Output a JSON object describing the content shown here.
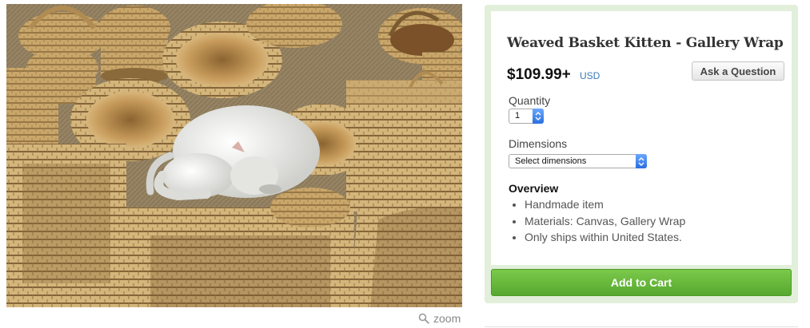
{
  "product": {
    "title": "Weaved Basket Kitten - Gallery Wrap",
    "price": "$109.99+",
    "currency": "USD",
    "ask_button": "Ask a Question",
    "quantity": {
      "label": "Quantity",
      "value": "1"
    },
    "dimensions": {
      "label": "Dimensions",
      "value": "Select dimensions"
    },
    "overview": {
      "heading": "Overview",
      "items": [
        "Handmade item",
        "Materials: Canvas, Gallery Wrap",
        "Only ships within United States."
      ]
    },
    "cart_button": "Add to Cart"
  },
  "photo": {
    "icon": "magnifier-icon",
    "zoom_label": "zoom",
    "colors": {
      "basket": "#c9a66a",
      "weave_dark": "#7a5a30",
      "cat": "#ededeb",
      "mat": "#9d8b6a"
    }
  },
  "colors": {
    "panel_bg": "#e2efda",
    "cart_green": "#6bbd3f",
    "currency_link": "#3a7ab8"
  }
}
